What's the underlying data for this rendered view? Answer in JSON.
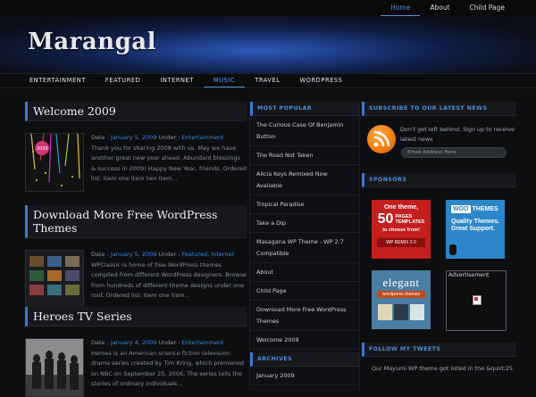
{
  "topnav": {
    "items": [
      "Home",
      "About",
      "Child Page"
    ]
  },
  "site": {
    "title": "Marangal"
  },
  "nav": {
    "items": [
      "ENTERTAINMENT",
      "FEATURED",
      "INTERNET",
      "MUSIC",
      "TRAVEL",
      "WORDPRESS"
    ]
  },
  "posts": [
    {
      "title": "Welcome 2009",
      "date_label": "Date :",
      "date": "January 5, 2009",
      "under_label": "Under :",
      "categories": "Entertainment",
      "excerpt": "Thank you for sharing 2008 with us. May we have another great new year ahead. Abundant blessings & success in 2009! Happy New Year, friends. Ordered list: Item one Item two Item…"
    },
    {
      "title": "Download More Free WordPress Themes",
      "date_label": "Date :",
      "date": "January 5, 2009",
      "under_label": "Under :",
      "categories": "Featured, Internet",
      "excerpt": "WPClassic is home of free WordPress themes compiled from different WordPress designers. Browse from hundreds of different theme designs under one roof. Ordered list: Item one Item…"
    },
    {
      "title": "Heroes TV Series",
      "date_label": "Date :",
      "date": "January 4, 2009",
      "under_label": "Under :",
      "categories": "Entertainment",
      "excerpt": "Heroes is an American science fiction television drama series created by Tim Kring, which premiered on NBC on September 25, 2006. The series tells the stories of ordinary individuals…"
    }
  ],
  "most_popular": {
    "title": "MOST POPULAR",
    "items": [
      "The Curious Case Of Benjamin Button",
      "The Road Not Taken",
      "Alicia Keys Remixed Now Available",
      "Tropical Paradise",
      "Take a Dip",
      "Masagana WP Theme - WP 2.7 Compatible",
      "About",
      "Child Page",
      "Download More Free WordPress Themes",
      "Welcome 2009"
    ]
  },
  "archives": {
    "title": "ARCHIVES",
    "items": [
      "January 2009"
    ]
  },
  "subscribe": {
    "title": "SUBSCRIBE TO OUR LATEST NEWS",
    "text": "Don't get left behind. Sign up to receive latest news",
    "email_placeholder": "Email Address Here"
  },
  "sponsors": {
    "title": "SPONSORS",
    "ad1": {
      "line1": "One theme,",
      "num": "50",
      "line2": "PAGES",
      "line3": "TEMPLATES",
      "line4": "to choose from!",
      "footer": "WP REMIX 2.0"
    },
    "ad2": {
      "brand": "WOO",
      "brand2": "THEMES",
      "line1": "Quality Themes.",
      "line2": "Great Support."
    },
    "ad3": {
      "brand": "elegant",
      "sub": "wordpress themes"
    },
    "ad4": {
      "label": "Advertisement"
    }
  },
  "tweets": {
    "title": "FOLLOW MY TWEETS",
    "text": "Our Mayumi WP theme got listed in the &quot;25"
  },
  "colors": {
    "accent": "#3b78d8",
    "link": "#3f86d8"
  }
}
